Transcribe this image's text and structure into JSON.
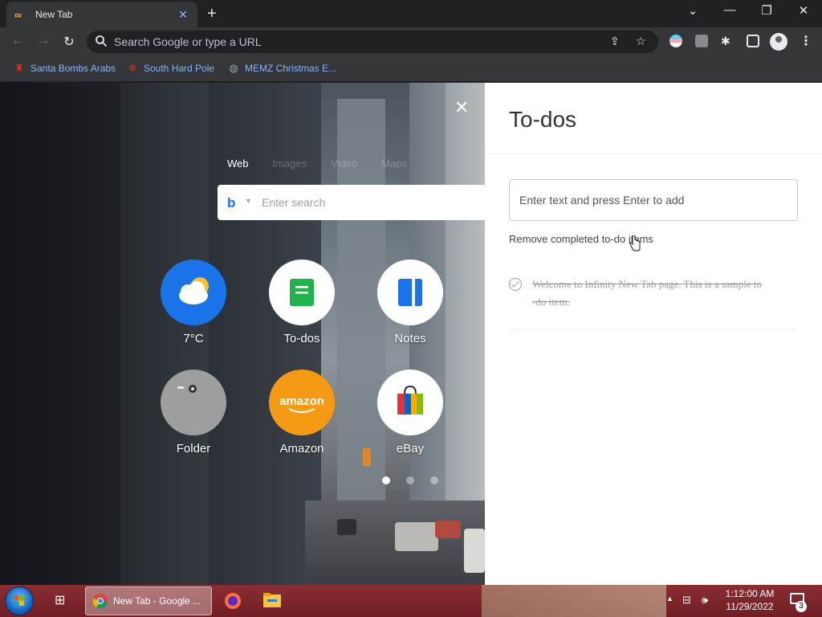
{
  "browser": {
    "tab": {
      "title": "New Tab",
      "favicon": "infinity-icon"
    },
    "omnibox": {
      "placeholder": "Search Google or type a URL"
    },
    "bookmarks": [
      {
        "label": "Santa Bombs Arabs",
        "icon": "santa-icon"
      },
      {
        "label": "South Hard Pole",
        "icon": "snowflake-icon"
      },
      {
        "label": "MEMZ Christmas E...",
        "icon": "globe-icon"
      }
    ]
  },
  "newtab": {
    "search_tabs": [
      "Web",
      "Images",
      "Video",
      "Maps"
    ],
    "search": {
      "engine_icon": "bing-icon",
      "placeholder": "Enter search"
    },
    "apps": [
      {
        "label": "7°C",
        "icon": "weather-icon",
        "color": "#1a73e8"
      },
      {
        "label": "To-dos",
        "icon": "todo-icon",
        "color": "#ffffff"
      },
      {
        "label": "Notes",
        "icon": "notes-icon",
        "color": "#ffffff"
      },
      {
        "label": "Folder",
        "icon": "folder-icon",
        "color": "#9e9e9e"
      },
      {
        "label": "Amazon",
        "icon": "amazon-icon",
        "logo_text": "amazon",
        "color": "#f59a13"
      },
      {
        "label": "eBay",
        "icon": "ebay-bag-icon",
        "color": "#ffffff"
      }
    ],
    "pages": {
      "count": 3,
      "active": 0
    }
  },
  "todos": {
    "title": "To-dos",
    "input_placeholder": "Enter text and press Enter to add",
    "remove_completed": "Remove completed to-do items",
    "items": [
      {
        "text": "Welcome to Infinity New Tab page. This is a sample to-do item.",
        "done": true
      }
    ]
  },
  "taskbar": {
    "active_window": "New Tab - Google ...",
    "time": "1:12:00 AM",
    "date": "11/29/2022",
    "notifications": "3"
  }
}
